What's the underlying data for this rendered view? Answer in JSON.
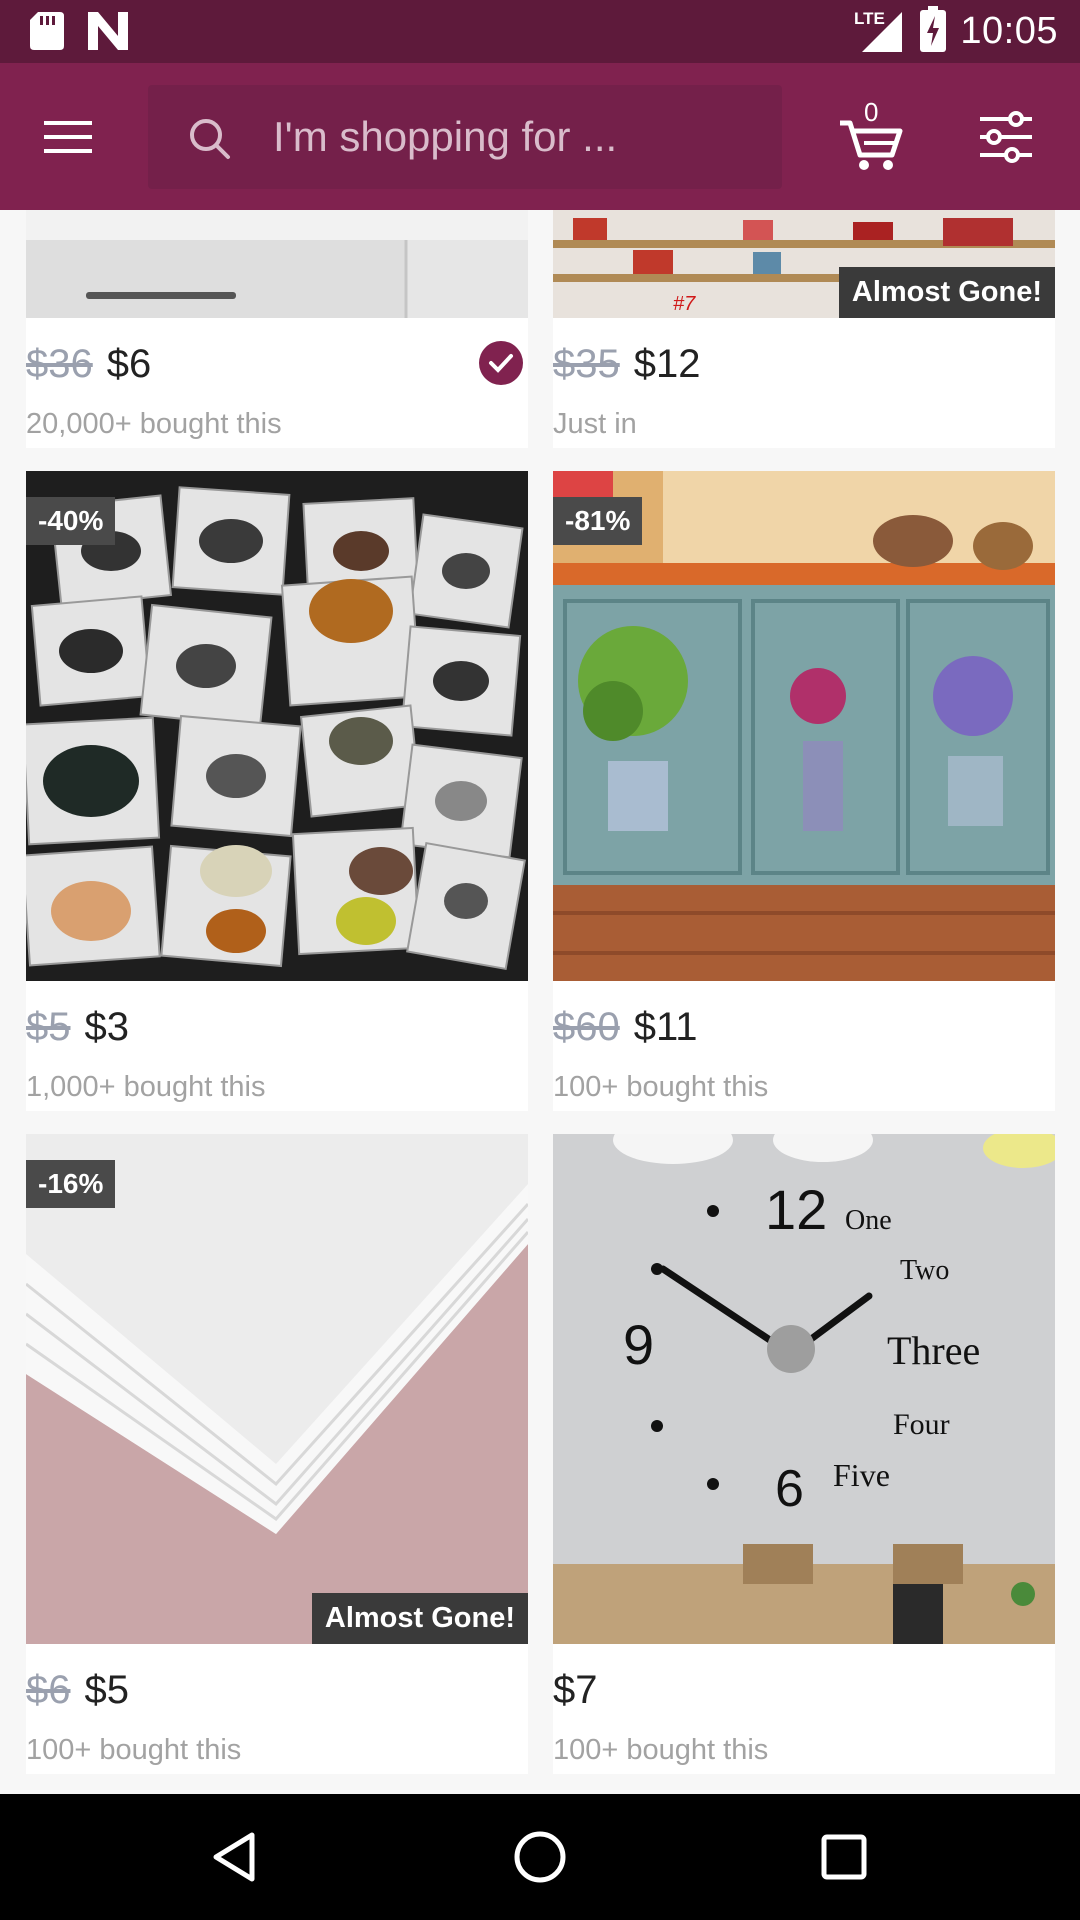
{
  "status_bar": {
    "time": "10:05",
    "network": "LTE",
    "icons": [
      "sd-card-icon",
      "n-logo-icon",
      "signal-icon",
      "battery-charging-icon"
    ]
  },
  "app_bar": {
    "menu_icon": "hamburger-menu-icon",
    "search_placeholder": "I'm shopping for ...",
    "cart_count": "0",
    "filter_icon": "filter-sliders-icon"
  },
  "colors": {
    "status_bar": "#5e1a3b",
    "app_bar": "#80224f",
    "accent": "#80224f"
  },
  "products": [
    {
      "old_price": "$36",
      "price": "$6",
      "sold": "20,000+ bought this",
      "verified": true
    },
    {
      "old_price": "$35",
      "price": "$12",
      "sold": "Just in",
      "badge": "Almost Gone!"
    },
    {
      "old_price": "$5",
      "price": "$3",
      "sold": "1,000+ bought this",
      "discount": "-40%"
    },
    {
      "old_price": "$60",
      "price": "$11",
      "sold": "100+ bought this",
      "discount": "-81%"
    },
    {
      "old_price": "$6",
      "price": "$5",
      "sold": "100+ bought this",
      "discount": "-16%",
      "badge": "Almost Gone!"
    },
    {
      "price": "$7",
      "sold": "100+ bought this"
    }
  ],
  "clock_image_text": {
    "n12": "12",
    "n9": "9",
    "n6": "6",
    "one": "One",
    "two": "Two",
    "three": "Three",
    "four": "Four",
    "five": "Five"
  },
  "nav_bar": {
    "icons": [
      "back-triangle-icon",
      "home-circle-icon",
      "recents-square-icon"
    ]
  }
}
